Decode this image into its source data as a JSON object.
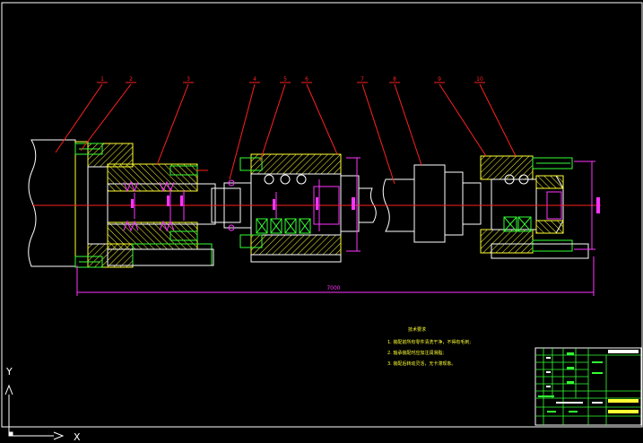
{
  "drawing": {
    "balloons": [
      {
        "label": "1"
      },
      {
        "label": "2"
      },
      {
        "label": "3"
      },
      {
        "label": "4"
      },
      {
        "label": "5"
      },
      {
        "label": "6"
      },
      {
        "label": "7"
      },
      {
        "label": "8"
      },
      {
        "label": "9"
      },
      {
        "label": "10"
      }
    ],
    "overall_dimension": "7000",
    "ucs": {
      "x_label": "X",
      "y_label": "Y"
    },
    "tech_requirements": {
      "title": "技术要求",
      "items": [
        "1. 装配前所有零件清洗干净，不得有毛刺;",
        "2. 轴承装配时应加注润滑脂;",
        "3. 装配后转动灵活，无卡滞现象。"
      ]
    }
  },
  "colors": {
    "background": "#000000",
    "red": "#ff2020",
    "yellow": "#ffff33",
    "green": "#33ff33",
    "white": "#ffffff",
    "magenta": "#ff33ff",
    "cyan": "#33ffff"
  }
}
